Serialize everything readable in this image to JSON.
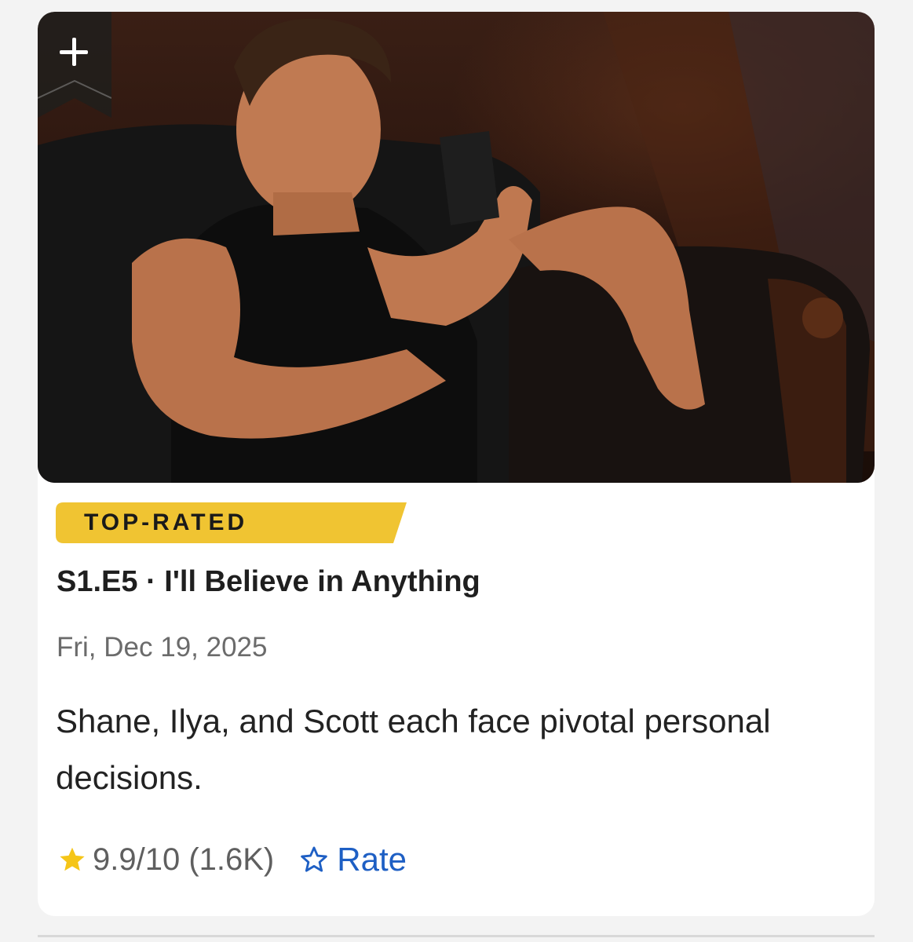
{
  "episode": {
    "badge": "TOP-RATED",
    "title": "S1.E5 · I'll Believe in Anything",
    "date": "Fri, Dec 19, 2025",
    "description": "Shane, Ilya, and Scott each face pivotal personal decisions.",
    "rating": "9.9/10 (1.6K)",
    "rate_label": "Rate",
    "thumbnail_icon": "still-image"
  },
  "colors": {
    "badge": "#f0c432",
    "star": "#f5c518",
    "rate": "#1e5fc4",
    "text": "#1f1f1f",
    "muted": "#6b6b6b"
  },
  "icons": {
    "watchlist": "plus-icon",
    "rating": "star-icon",
    "rate": "star-outline-icon"
  }
}
